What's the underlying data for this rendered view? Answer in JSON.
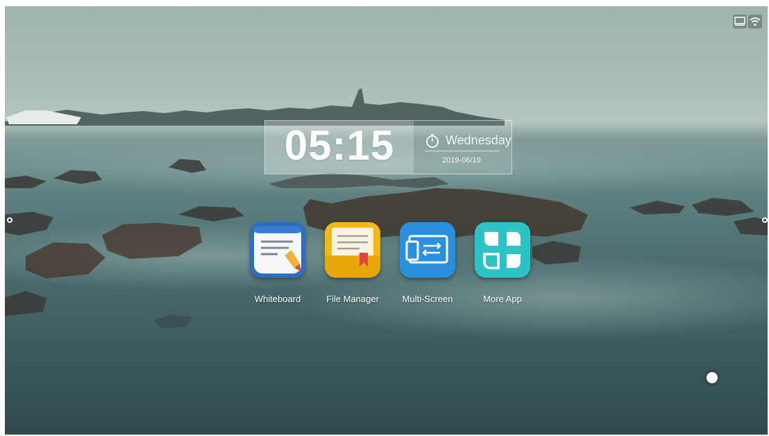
{
  "clock": {
    "time": "05:15",
    "day": "Wednesday",
    "date": "2019-06/19",
    "icon": "timer-icon"
  },
  "apps": [
    {
      "label": "Whiteboard",
      "icon": "whiteboard-icon",
      "color": "#2a6fc4"
    },
    {
      "label": "File Manager",
      "icon": "folder-bookmark-icon",
      "color": "#f2b914"
    },
    {
      "label": "Multi-Screen",
      "icon": "multi-screen-icon",
      "color": "#2b8fe0"
    },
    {
      "label": "More App",
      "icon": "grid-apps-icon",
      "color": "#2dc2c6"
    }
  ],
  "status_bar": {
    "icons": [
      "screen-mirror-icon",
      "wifi-icon"
    ]
  },
  "colors": {
    "water_dark": "#2f4a4d",
    "sky": "#a9bcb6"
  }
}
